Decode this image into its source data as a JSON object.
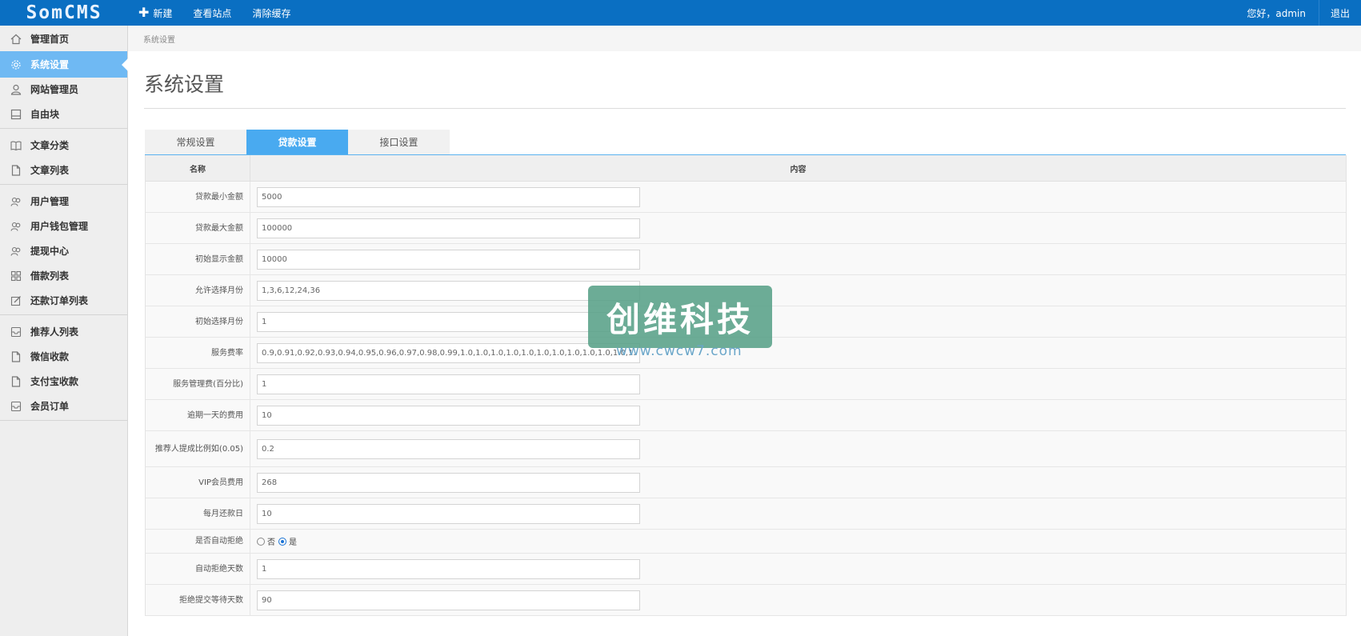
{
  "app": {
    "logo": "SomCMS"
  },
  "topnav": {
    "new_label": "新建",
    "view_site_label": "查看站点",
    "clear_cache_label": "清除缓存",
    "greeting": "您好，admin",
    "logout_label": "退出"
  },
  "sidebar": {
    "items": [
      {
        "label": "管理首页",
        "icon": "home-icon"
      },
      {
        "label": "系统设置",
        "icon": "gear-icon",
        "active": true
      },
      {
        "label": "网站管理员",
        "icon": "user-icon"
      },
      {
        "label": "自由块",
        "icon": "block-icon"
      },
      {
        "label": "文章分类",
        "icon": "book-icon"
      },
      {
        "label": "文章列表",
        "icon": "file-icon"
      },
      {
        "label": "用户管理",
        "icon": "users-icon"
      },
      {
        "label": "用户钱包管理",
        "icon": "users-icon"
      },
      {
        "label": "提现中心",
        "icon": "users-icon"
      },
      {
        "label": "借款列表",
        "icon": "grid-icon"
      },
      {
        "label": "还款订单列表",
        "icon": "edit-icon"
      },
      {
        "label": "推荐人列表",
        "icon": "inbox-icon"
      },
      {
        "label": "微信收款",
        "icon": "file-icon"
      },
      {
        "label": "支付宝收款",
        "icon": "file-icon"
      },
      {
        "label": "会员订单",
        "icon": "inbox-icon"
      }
    ]
  },
  "breadcrumb": "系统设置",
  "page": {
    "title": "系统设置"
  },
  "tabs": [
    {
      "label": "常规设置",
      "active": false
    },
    {
      "label": "贷款设置",
      "active": true
    },
    {
      "label": "接口设置",
      "active": false
    }
  ],
  "table": {
    "col_name": "名称",
    "col_content": "内容",
    "rows": [
      {
        "label": "贷款最小金额",
        "value": "5000"
      },
      {
        "label": "贷款最大金额",
        "value": "100000"
      },
      {
        "label": "初始显示金额",
        "value": "10000"
      },
      {
        "label": "允许选择月份",
        "value": "1,3,6,12,24,36"
      },
      {
        "label": "初始选择月份",
        "value": "1"
      },
      {
        "label": "服务费率",
        "value": "0.9,0.91,0.92,0.93,0.94,0.95,0.96,0.97,0.98,0.99,1.0,1.0,1.0,1.0,1.0,1.0,1.0,1.0,1.0,1.0,1.0,1.0,1.0,1.0,1"
      },
      {
        "label": "服务管理费(百分比)",
        "value": "1"
      },
      {
        "label": "逾期一天的费用",
        "value": "10"
      },
      {
        "label": "推荐人提成比例如(0.05)",
        "value": "0.2"
      },
      {
        "label": "VIP会员费用",
        "value": "268"
      },
      {
        "label": "每月还款日",
        "value": "10"
      },
      {
        "label": "是否自动拒绝",
        "radio": {
          "options": [
            "否",
            "是"
          ],
          "selected": "是"
        }
      },
      {
        "label": "自动拒绝天数",
        "value": "1"
      },
      {
        "label": "拒绝提交等待天数",
        "value": "90"
      }
    ]
  },
  "watermark": {
    "text": "创维科技",
    "url": "www.cwcw7.com"
  }
}
